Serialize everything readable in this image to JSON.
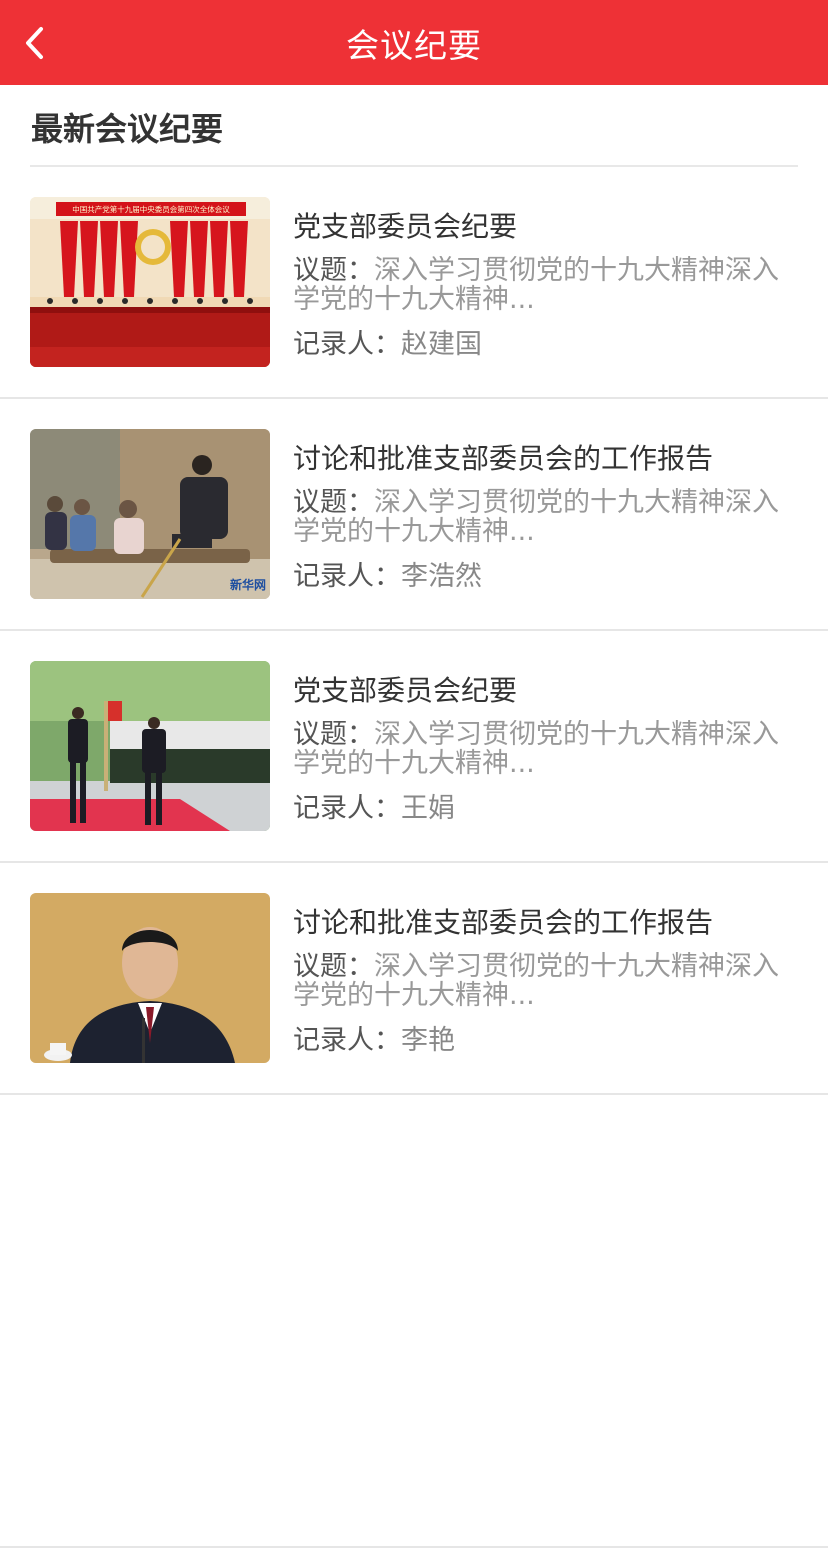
{
  "nav": {
    "title": "会议纪要",
    "back_icon": "chevron-left-icon"
  },
  "colors": {
    "primary": "#ee3136",
    "title_text": "#333333",
    "muted_text": "#999999"
  },
  "section": {
    "title": "最新会议纪要"
  },
  "labels": {
    "topic": "议题：",
    "recorder": "记录人："
  },
  "items": [
    {
      "title": "党支部委员会纪要",
      "topic": "深入学习贯彻党的十九大精神深入学党的十九大精神...",
      "recorder": "赵建国",
      "image": "party-congress-meeting-photo",
      "image_banner": "中国共产党第十九届中央委员会第四次全体会议"
    },
    {
      "title": "讨论和批准支部委员会的工作报告",
      "topic": "深入学习贯彻党的十九大精神深入学党的十九大精神...",
      "recorder": "李浩然",
      "image": "villagers-seated-outdoors-photo",
      "image_watermark": "新华网"
    },
    {
      "title": "党支部委员会纪要",
      "topic": "深入学习贯彻党的十九大精神深入学党的十九大精神...",
      "recorder": "王娟",
      "image": "honor-guard-review-photo"
    },
    {
      "title": "讨论和批准支部委员会的工作报告",
      "topic": "深入学习贯彻党的十九大精神深入学党的十九大精神...",
      "recorder": "李艳",
      "image": "speaker-portrait-photo"
    }
  ]
}
